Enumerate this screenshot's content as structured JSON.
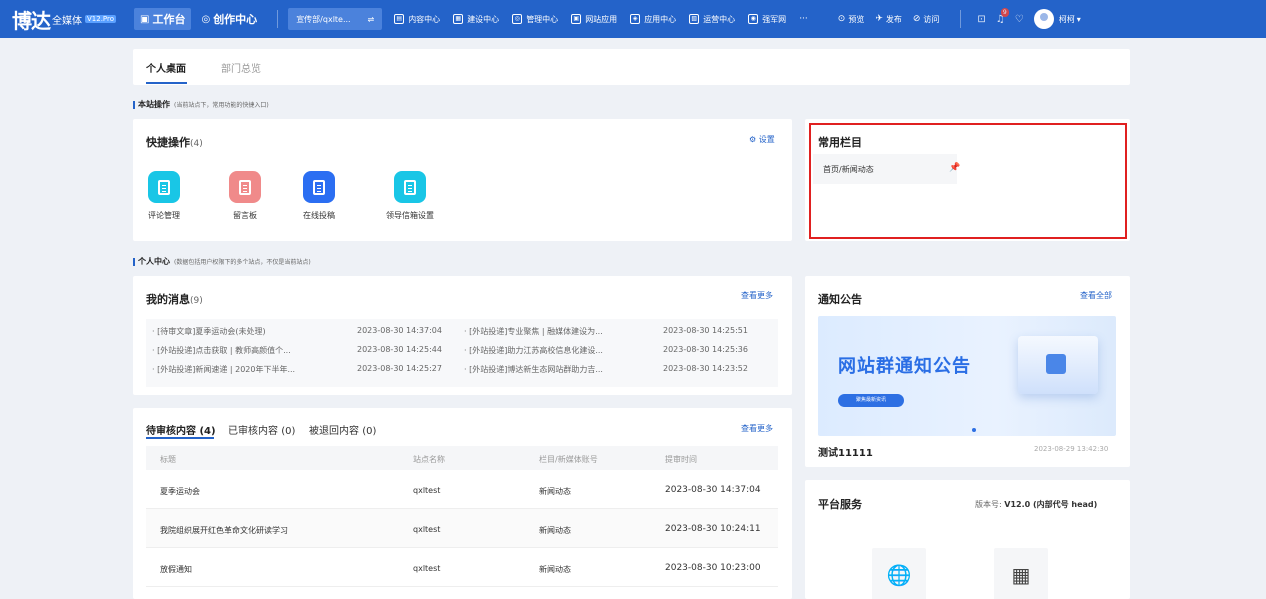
{
  "header": {
    "logo_mark": "博达",
    "logo_text": "全媒体",
    "logo_version": "V12.Pro",
    "mode_tabs": [
      {
        "icon": "▣",
        "label": "工作台"
      },
      {
        "icon": "◎",
        "label": "创作中心"
      }
    ],
    "site_select": {
      "value": "宣传部/qxlte...",
      "icon": "⇌"
    },
    "nav_items": [
      {
        "icon": "▤",
        "label": "内容中心"
      },
      {
        "icon": "▦",
        "label": "建设中心"
      },
      {
        "icon": "◎",
        "label": "管理中心"
      },
      {
        "icon": "▣",
        "label": "网站应用"
      },
      {
        "icon": "◈",
        "label": "应用中心"
      },
      {
        "icon": "▧",
        "label": "运营中心"
      },
      {
        "icon": "◉",
        "label": "强军网"
      }
    ],
    "nav_more": "···",
    "tools": [
      {
        "icon": "⊙",
        "label": "预览"
      },
      {
        "icon": "✈",
        "label": "发布"
      },
      {
        "icon": "⊘",
        "label": "访问"
      }
    ],
    "notification_count": "9",
    "user_name": "柯柯",
    "user_caret": "▾"
  },
  "tabs": {
    "personal": "个人桌面",
    "department": "部门总览"
  },
  "site_ops": {
    "title": "本站操作",
    "subtitle": "(当前站点下，常用功能的快捷入口)"
  },
  "quick_actions": {
    "title": "快捷操作",
    "count": "(4)",
    "settings_icon": "⚙",
    "settings_label": "设置",
    "items": [
      {
        "label": "评论管理",
        "color": "#19c6e6"
      },
      {
        "label": "留言板",
        "color": "#f08a8a"
      },
      {
        "label": "在线投稿",
        "color": "#2b6ef2"
      },
      {
        "label": "领导信箱设置",
        "color": "#19c6e6"
      }
    ]
  },
  "frequent": {
    "title": "常用栏目",
    "items": [
      {
        "label": "首页/新闻动态",
        "pin": "📌"
      }
    ]
  },
  "personal_center": {
    "title": "个人中心",
    "subtitle": "(数据包括用户权限下的多个站点，不仅是当前站点)"
  },
  "messages": {
    "title": "我的消息",
    "count": "(9)",
    "more": "查看更多",
    "items": [
      {
        "text": "· [待审文章]夏季运动会(未处理)",
        "time": "2023-08-30 14:37:04"
      },
      {
        "text": "· [外站投递]专业聚焦 | 融媒体建设为...",
        "time": "2023-08-30 14:25:51"
      },
      {
        "text": "· [外站投递]点击获取 | 教师高颜值个...",
        "time": "2023-08-30 14:25:44"
      },
      {
        "text": "· [外站投递]助力江苏高校信息化建设...",
        "time": "2023-08-30 14:25:36"
      },
      {
        "text": "· [外站投递]新闻速递 | 2020年下半年...",
        "time": "2023-08-30 14:25:27"
      },
      {
        "text": "· [外站投递]博达新生态网站群助力吉...",
        "time": "2023-08-30 14:23:52"
      }
    ]
  },
  "pending": {
    "tabs": [
      {
        "label": "待审核内容",
        "count": "(4)"
      },
      {
        "label": "已审核内容",
        "count": "(0)"
      },
      {
        "label": "被退回内容",
        "count": "(0)"
      }
    ],
    "more": "查看更多",
    "columns": [
      "标题",
      "站点名称",
      "栏目/新媒体账号",
      "提审时间"
    ],
    "rows": [
      {
        "title": "夏季运动会",
        "site": "qxltest",
        "column": "新闻动态",
        "time": "2023-08-30 14:37:04"
      },
      {
        "title": "我院组织展开红色革命文化研读学习",
        "site": "qxltest",
        "column": "新闻动态",
        "time": "2023-08-30 10:24:11"
      },
      {
        "title": "放假通知",
        "site": "qxltest",
        "column": "新闻动态",
        "time": "2023-08-30 10:23:00"
      }
    ]
  },
  "notice": {
    "title": "通知公告",
    "more": "查看全部",
    "banner_title": "网站群通知公告",
    "banner_button": "聚焦最新资讯",
    "item_title": "测试11111",
    "item_date": "2023-08-29 13:42:30"
  },
  "platform": {
    "title": "平台服务",
    "version_label": "版本号:",
    "version_value": "V12.0 (内部代号 head)",
    "services": [
      {
        "icon": "🌐"
      },
      {
        "icon": "▦"
      }
    ]
  },
  "colors": {
    "primary": "#2463c9",
    "highlight_border": "#e02020"
  }
}
